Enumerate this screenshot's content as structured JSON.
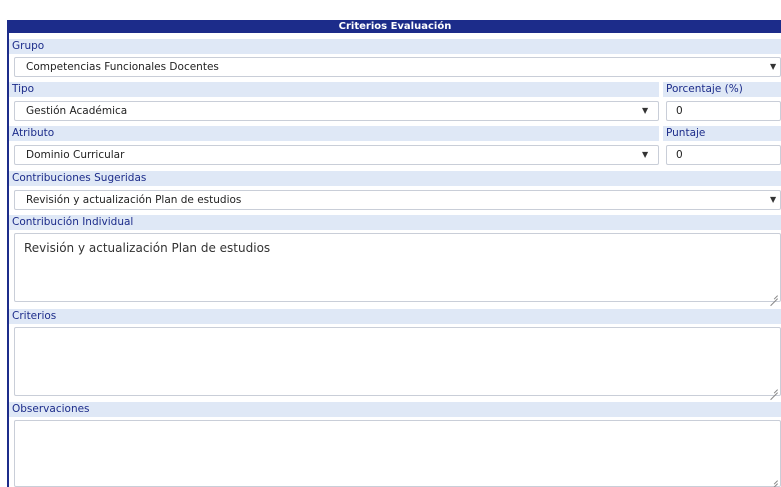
{
  "header": {
    "title": "Criterios Evaluación"
  },
  "grupo": {
    "label": "Grupo",
    "value": "Competencias Funcionales Docentes",
    "icon": "caret-down-icon"
  },
  "tipo": {
    "label": "Tipo",
    "value": "Gestión Académica",
    "icon": "caret-down-icon"
  },
  "porcentaje": {
    "label": "Porcentaje (%)",
    "value": "0"
  },
  "atributo": {
    "label": "Atributo",
    "value": "Dominio Curricular",
    "icon": "caret-down-icon"
  },
  "puntaje": {
    "label": "Puntaje",
    "value": "0"
  },
  "contribuciones": {
    "label": "Contribuciones Sugeridas",
    "value": "Revisión y actualización Plan de estudios",
    "icon": "caret-down-icon"
  },
  "contribucion_individual": {
    "label": "Contribución Individual",
    "value": "Revisión y actualización Plan de estudios"
  },
  "criterios": {
    "label": "Criterios",
    "value": ""
  },
  "observaciones": {
    "label": "Observaciones",
    "value": ""
  },
  "colors": {
    "header": "#1c2c8a",
    "label_bg": "#dfe8f6",
    "label_text": "#1c2c8a"
  }
}
